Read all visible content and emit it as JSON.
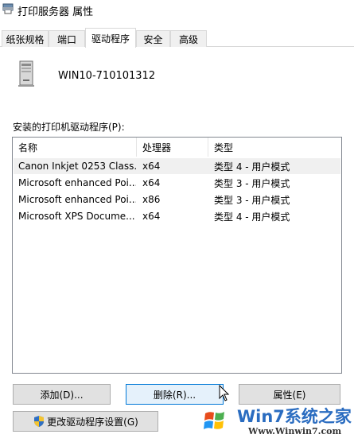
{
  "window": {
    "title": "打印服务器 属性"
  },
  "tabs": [
    {
      "label": "纸张规格",
      "active": false
    },
    {
      "label": "端口",
      "active": false
    },
    {
      "label": "驱动程序",
      "active": true
    },
    {
      "label": "安全",
      "active": false
    },
    {
      "label": "高级",
      "active": false
    }
  ],
  "server": {
    "name": "WIN10-710101312",
    "icon": "computer-tower-icon"
  },
  "drivers": {
    "label": "安装的打印机驱动程序(P):",
    "columns": [
      "名称",
      "处理器",
      "类型"
    ],
    "rows": [
      {
        "name": "Canon Inkjet 0253 Class...",
        "processor": "x64",
        "type": "类型 4 - 用户模式"
      },
      {
        "name": "Microsoft enhanced Poi...",
        "processor": "x64",
        "type": "类型 3 - 用户模式"
      },
      {
        "name": "Microsoft enhanced Poi...",
        "processor": "x86",
        "type": "类型 3 - 用户模式"
      },
      {
        "name": "Microsoft XPS Docume...",
        "processor": "x64",
        "type": "类型 4 - 用户模式"
      }
    ]
  },
  "buttons": {
    "add": "添加(D)...",
    "remove": "删除(R)...",
    "properties": "属性(E)",
    "change_settings": "更改驱动程序设置(G)"
  },
  "watermark": {
    "brand": "Win7系统之家",
    "url": "Www.Winwin7.com"
  }
}
